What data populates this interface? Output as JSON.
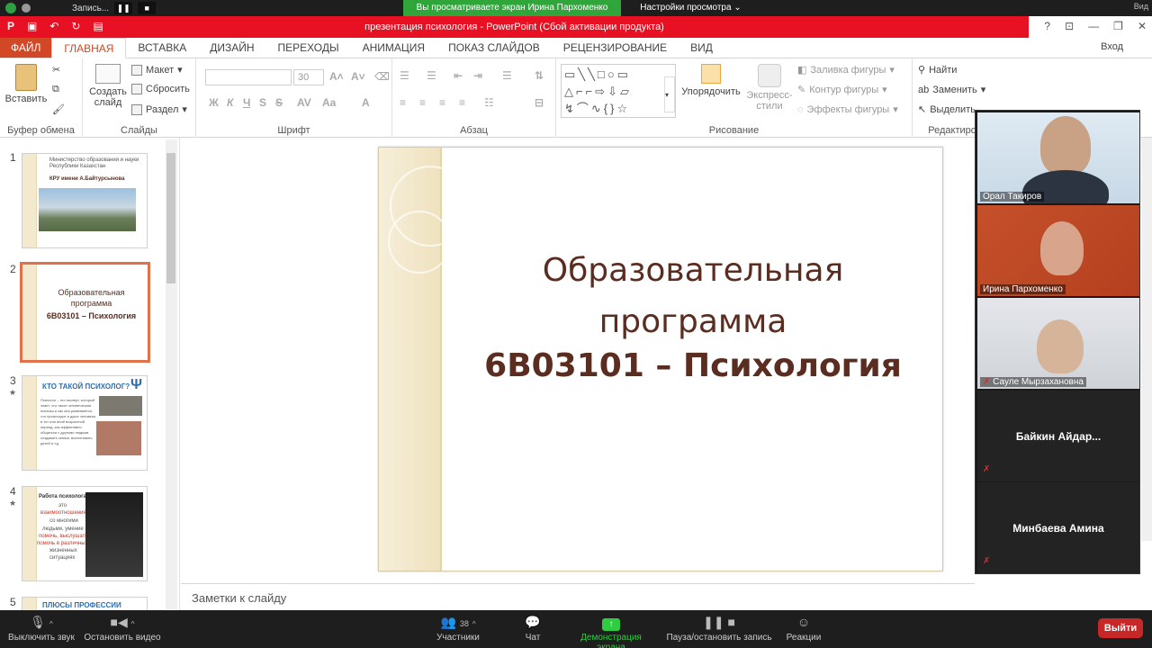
{
  "zoom_top": {
    "recording_label": "Запись...",
    "share_banner": "Вы просматриваете экран Ирина Пархоменко",
    "view_options": "Настройки просмотра",
    "view_right": "Вид"
  },
  "title_bar": {
    "title": "презентация психология -  PowerPoint (Сбой активации продукта)",
    "sign_in": "Вход"
  },
  "ribbon_tabs": [
    "ФАЙЛ",
    "ГЛАВНАЯ",
    "ВСТАВКА",
    "ДИЗАЙН",
    "ПЕРЕХОДЫ",
    "АНИМАЦИЯ",
    "ПОКАЗ СЛАЙДОВ",
    "РЕЦЕНЗИРОВАНИЕ",
    "ВИД"
  ],
  "ribbon": {
    "clipboard": {
      "paste": "Вставить",
      "label": "Буфер обмена"
    },
    "slides": {
      "new_slide_1": "Создать",
      "new_slide_2": "слайд",
      "layout": "Макет",
      "reset": "Сбросить",
      "section": "Раздел",
      "label": "Слайды"
    },
    "font": {
      "size": "30",
      "label": "Шрифт",
      "bold": "Ж",
      "italic": "К",
      "underline": "Ч",
      "strike": "S",
      "aa": "Aa",
      "color": "A"
    },
    "paragraph": {
      "label": "Абзац"
    },
    "drawing": {
      "arrange": "Упорядочить",
      "quick_styles_1": "Экспресс-",
      "quick_styles_2": "стили",
      "fill": "Заливка фигуры",
      "outline": "Контур фигуры",
      "effects": "Эффекты фигуры",
      "label": "Рисование"
    },
    "editing": {
      "find": "Найти",
      "replace": "Заменить",
      "select": "Выделить",
      "label": "Редактирова"
    }
  },
  "thumbnails": {
    "numbers": [
      "1",
      "2",
      "3",
      "4",
      "5"
    ],
    "t1_line1": "Министерство образования и науки",
    "t1_line2": "Республики Казахстан",
    "t1_uni": "КРУ имени А.Байтурсынова",
    "t2_line1": "Образовательная",
    "t2_line2": "программа",
    "t2_line3": "6В03101 – Психология",
    "t3_title": "КТО ТАКОЙ ПСИХОЛОГ?",
    "t3_symbol": "Ψ",
    "t3_text": "Психолог – это эксперт, который знает, что такое человеческая психика и как она развивается, что происходит в душе человека в тот или иной возрастной период, как эффективно общаться с другими людьми, создавать семью, воспитывать детей и т.д.",
    "t4_line1": "Работа психолога –",
    "t4_line2": "это",
    "t4_line3": "взаимоотношения",
    "t4_line4": "со многими",
    "t4_line5": "людьми, умение",
    "t4_line6": "помочь, выслушать,",
    "t4_line7": "помочь в различных",
    "t4_line8": "жизненных",
    "t4_line9": "ситуациях",
    "t5_title": "ПЛЮСЫ ПРОФЕССИИ"
  },
  "slide": {
    "title_line1": "Образовательная",
    "title_line2": "программа",
    "code": "6В03101 – Психология"
  },
  "notes_placeholder": "Заметки к слайду",
  "participants": [
    {
      "name": "Орал Такиров"
    },
    {
      "name": "Ирина Пархоменко"
    },
    {
      "name": "Сауле Мырзахановна"
    },
    {
      "name": "Байкин  Айдар..."
    },
    {
      "name": "Минбаева Амина"
    }
  ],
  "toolbar": {
    "mute": "Выключить звук",
    "video": "Остановить видео",
    "participants": "Участники",
    "participants_count": "38",
    "chat": "Чат",
    "share": "Демонстрация экрана",
    "record": "Пауза/остановить запись",
    "reactions": "Реакции",
    "leave": "Выйти"
  },
  "colors": {
    "ppt_accent": "#d24726",
    "title_bar_red": "#e81123",
    "zoom_green": "#30a53a",
    "slide_text": "#5a2d20",
    "leave_red": "#c62828"
  }
}
